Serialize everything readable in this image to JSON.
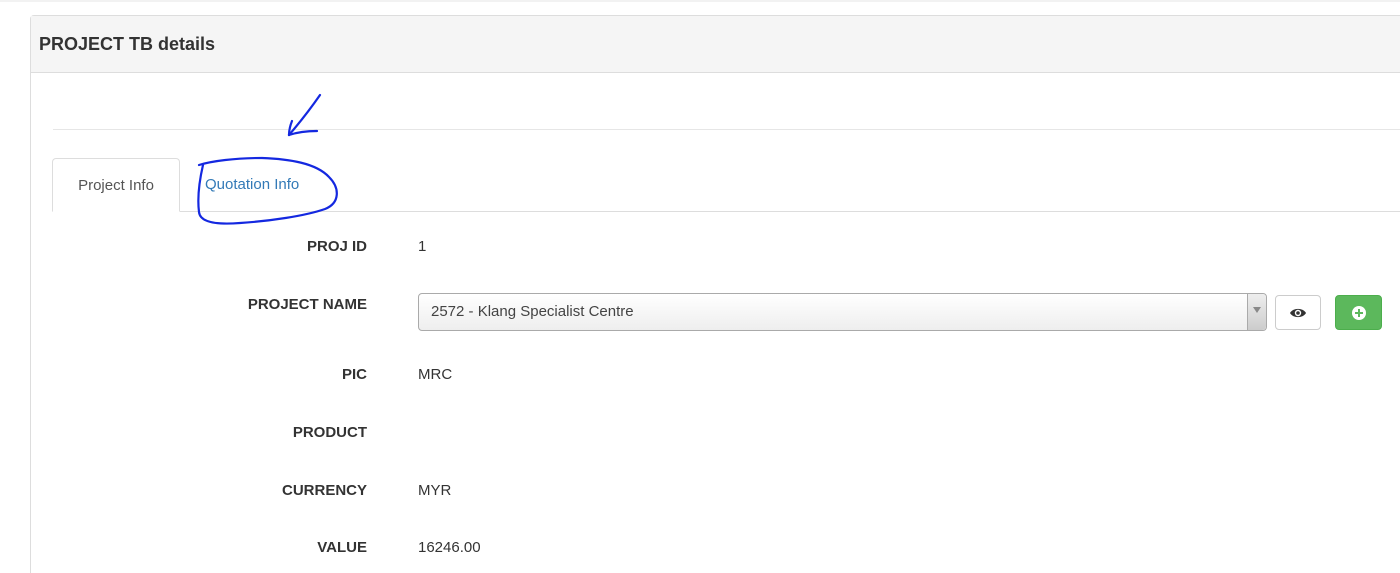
{
  "panel": {
    "title": "PROJECT TB details"
  },
  "tabs": [
    {
      "label": "Project Info",
      "active": true
    },
    {
      "label": "Quotation Info",
      "active": false
    }
  ],
  "fields": {
    "proj_id": {
      "label": "PROJ ID",
      "value": "1"
    },
    "project_name": {
      "label": "PROJECT NAME",
      "selected": "2572 - Klang Specialist Centre"
    },
    "pic": {
      "label": "PIC",
      "value": "MRC"
    },
    "product": {
      "label": "PRODUCT",
      "value": ""
    },
    "currency": {
      "label": "CURRENCY",
      "value": "MYR"
    },
    "value": {
      "label": "VALUE",
      "value": "16246.00"
    }
  },
  "buttons": {
    "view": {
      "icon": "eye-icon"
    },
    "add": {
      "icon": "plus-circle-icon"
    }
  },
  "annotation": {
    "color": "#1428e0",
    "marks": [
      "arrow-mark",
      "circle-mark"
    ]
  },
  "colors": {
    "link": "#337ab7",
    "success": "#5cb85c",
    "heading_bg": "#f5f5f5"
  }
}
